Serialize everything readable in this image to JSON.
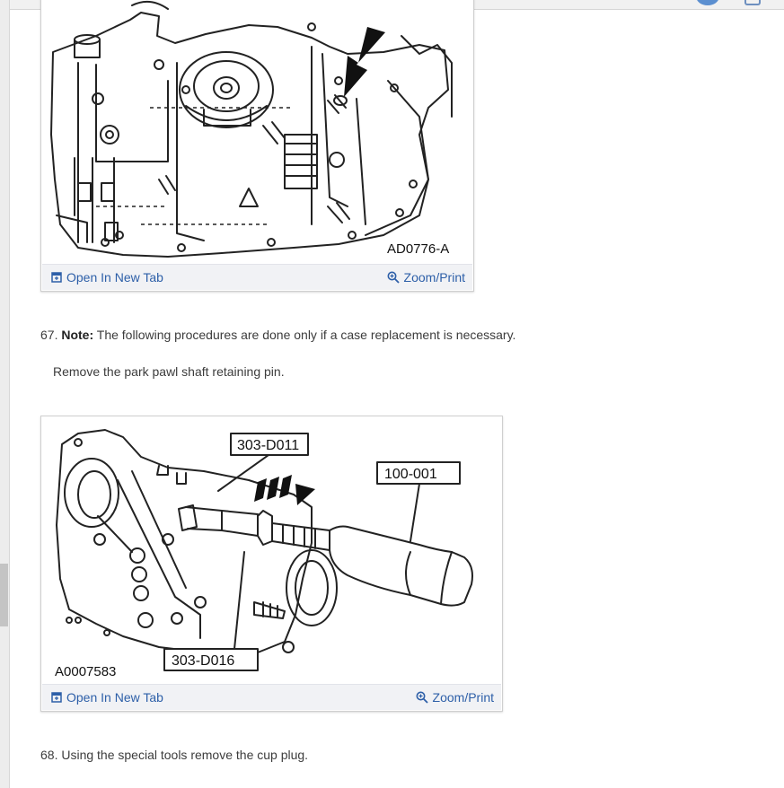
{
  "figure1": {
    "code": "AD0776-A",
    "open_link": "Open In New Tab",
    "zoom_link": "Zoom/Print"
  },
  "step67": {
    "number": "67.",
    "note_label": "Note:",
    "note_text": "The following procedures are done only if a case replacement is necessary.",
    "instruction": "Remove the park pawl shaft retaining pin."
  },
  "figure2": {
    "code": "A0007583",
    "callouts": [
      "303-D011",
      "100-001",
      "303-D016"
    ],
    "open_link": "Open In New Tab",
    "zoom_link": "Zoom/Print"
  },
  "step68": {
    "number": "68.",
    "text": "Using the special tools remove the cup plug."
  },
  "colors": {
    "link": "#2d5fa8",
    "bar": "#f1f2f5",
    "text": "#3c3c3c"
  },
  "icons": [
    "open-new-tab-icon",
    "zoom-magnifier-icon"
  ]
}
